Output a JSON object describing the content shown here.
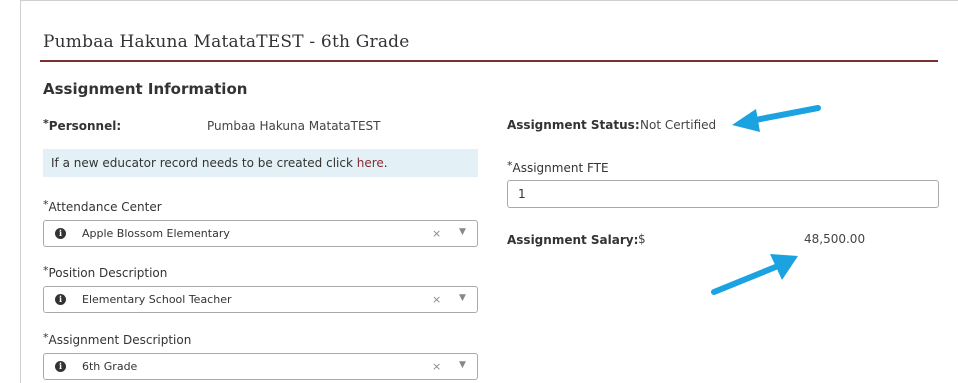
{
  "page_title": "Pumbaa Hakuna MatataTEST - 6th Grade",
  "section_title": "Assignment Information",
  "required_marker": "*",
  "personnel": {
    "label": "Personnel:",
    "value": "Pumbaa Hakuna MatataTEST"
  },
  "info_box": {
    "text": "If a new educator record needs to be created click ",
    "link": "here",
    "end": "."
  },
  "attendance_center": {
    "label": "Attendance Center",
    "value": "Apple Blossom Elementary"
  },
  "position_description": {
    "label": "Position Description",
    "value": "Elementary School Teacher"
  },
  "assignment_description": {
    "label": "Assignment Description",
    "value": "6th Grade"
  },
  "assignment_status": {
    "label": "Assignment Status:",
    "value": "Not Certified"
  },
  "assignment_fte": {
    "label": "Assignment FTE",
    "value": "1"
  },
  "assignment_salary": {
    "label": "Assignment Salary:",
    "currency": "$",
    "value": "48,500.00"
  },
  "icons": {
    "info": "info-icon",
    "clear": "clear-icon",
    "caret": "chevron-down-icon",
    "arrow": "arrow-icon"
  },
  "glyphs": {
    "info": "i",
    "clear": "×",
    "caret": "▼"
  },
  "colors": {
    "accent_rule": "#7a3033",
    "link": "#8a2b31",
    "info_bg": "#e3f1f7",
    "arrow": "#1aa3e0"
  }
}
